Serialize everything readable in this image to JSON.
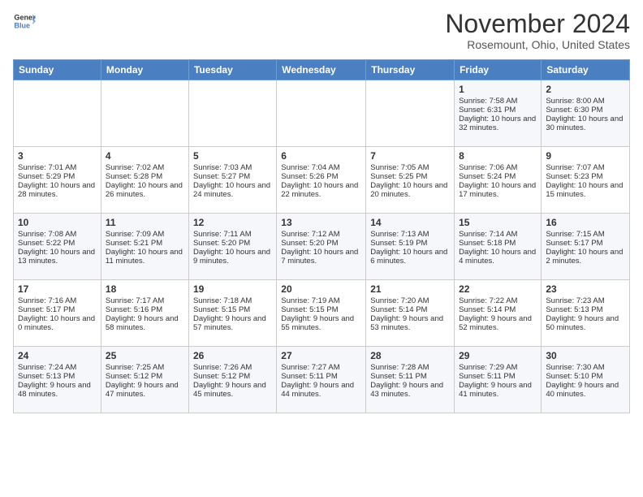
{
  "logo": {
    "line1": "General",
    "line2": "Blue"
  },
  "title": "November 2024",
  "location": "Rosemount, Ohio, United States",
  "headers": [
    "Sunday",
    "Monday",
    "Tuesday",
    "Wednesday",
    "Thursday",
    "Friday",
    "Saturday"
  ],
  "rows": [
    [
      {
        "day": "",
        "sunrise": "",
        "sunset": "",
        "daylight": ""
      },
      {
        "day": "",
        "sunrise": "",
        "sunset": "",
        "daylight": ""
      },
      {
        "day": "",
        "sunrise": "",
        "sunset": "",
        "daylight": ""
      },
      {
        "day": "",
        "sunrise": "",
        "sunset": "",
        "daylight": ""
      },
      {
        "day": "",
        "sunrise": "",
        "sunset": "",
        "daylight": ""
      },
      {
        "day": "1",
        "sunrise": "Sunrise: 7:58 AM",
        "sunset": "Sunset: 6:31 PM",
        "daylight": "Daylight: 10 hours and 32 minutes."
      },
      {
        "day": "2",
        "sunrise": "Sunrise: 8:00 AM",
        "sunset": "Sunset: 6:30 PM",
        "daylight": "Daylight: 10 hours and 30 minutes."
      }
    ],
    [
      {
        "day": "3",
        "sunrise": "Sunrise: 7:01 AM",
        "sunset": "Sunset: 5:29 PM",
        "daylight": "Daylight: 10 hours and 28 minutes."
      },
      {
        "day": "4",
        "sunrise": "Sunrise: 7:02 AM",
        "sunset": "Sunset: 5:28 PM",
        "daylight": "Daylight: 10 hours and 26 minutes."
      },
      {
        "day": "5",
        "sunrise": "Sunrise: 7:03 AM",
        "sunset": "Sunset: 5:27 PM",
        "daylight": "Daylight: 10 hours and 24 minutes."
      },
      {
        "day": "6",
        "sunrise": "Sunrise: 7:04 AM",
        "sunset": "Sunset: 5:26 PM",
        "daylight": "Daylight: 10 hours and 22 minutes."
      },
      {
        "day": "7",
        "sunrise": "Sunrise: 7:05 AM",
        "sunset": "Sunset: 5:25 PM",
        "daylight": "Daylight: 10 hours and 20 minutes."
      },
      {
        "day": "8",
        "sunrise": "Sunrise: 7:06 AM",
        "sunset": "Sunset: 5:24 PM",
        "daylight": "Daylight: 10 hours and 17 minutes."
      },
      {
        "day": "9",
        "sunrise": "Sunrise: 7:07 AM",
        "sunset": "Sunset: 5:23 PM",
        "daylight": "Daylight: 10 hours and 15 minutes."
      }
    ],
    [
      {
        "day": "10",
        "sunrise": "Sunrise: 7:08 AM",
        "sunset": "Sunset: 5:22 PM",
        "daylight": "Daylight: 10 hours and 13 minutes."
      },
      {
        "day": "11",
        "sunrise": "Sunrise: 7:09 AM",
        "sunset": "Sunset: 5:21 PM",
        "daylight": "Daylight: 10 hours and 11 minutes."
      },
      {
        "day": "12",
        "sunrise": "Sunrise: 7:11 AM",
        "sunset": "Sunset: 5:20 PM",
        "daylight": "Daylight: 10 hours and 9 minutes."
      },
      {
        "day": "13",
        "sunrise": "Sunrise: 7:12 AM",
        "sunset": "Sunset: 5:20 PM",
        "daylight": "Daylight: 10 hours and 7 minutes."
      },
      {
        "day": "14",
        "sunrise": "Sunrise: 7:13 AM",
        "sunset": "Sunset: 5:19 PM",
        "daylight": "Daylight: 10 hours and 6 minutes."
      },
      {
        "day": "15",
        "sunrise": "Sunrise: 7:14 AM",
        "sunset": "Sunset: 5:18 PM",
        "daylight": "Daylight: 10 hours and 4 minutes."
      },
      {
        "day": "16",
        "sunrise": "Sunrise: 7:15 AM",
        "sunset": "Sunset: 5:17 PM",
        "daylight": "Daylight: 10 hours and 2 minutes."
      }
    ],
    [
      {
        "day": "17",
        "sunrise": "Sunrise: 7:16 AM",
        "sunset": "Sunset: 5:17 PM",
        "daylight": "Daylight: 10 hours and 0 minutes."
      },
      {
        "day": "18",
        "sunrise": "Sunrise: 7:17 AM",
        "sunset": "Sunset: 5:16 PM",
        "daylight": "Daylight: 9 hours and 58 minutes."
      },
      {
        "day": "19",
        "sunrise": "Sunrise: 7:18 AM",
        "sunset": "Sunset: 5:15 PM",
        "daylight": "Daylight: 9 hours and 57 minutes."
      },
      {
        "day": "20",
        "sunrise": "Sunrise: 7:19 AM",
        "sunset": "Sunset: 5:15 PM",
        "daylight": "Daylight: 9 hours and 55 minutes."
      },
      {
        "day": "21",
        "sunrise": "Sunrise: 7:20 AM",
        "sunset": "Sunset: 5:14 PM",
        "daylight": "Daylight: 9 hours and 53 minutes."
      },
      {
        "day": "22",
        "sunrise": "Sunrise: 7:22 AM",
        "sunset": "Sunset: 5:14 PM",
        "daylight": "Daylight: 9 hours and 52 minutes."
      },
      {
        "day": "23",
        "sunrise": "Sunrise: 7:23 AM",
        "sunset": "Sunset: 5:13 PM",
        "daylight": "Daylight: 9 hours and 50 minutes."
      }
    ],
    [
      {
        "day": "24",
        "sunrise": "Sunrise: 7:24 AM",
        "sunset": "Sunset: 5:13 PM",
        "daylight": "Daylight: 9 hours and 48 minutes."
      },
      {
        "day": "25",
        "sunrise": "Sunrise: 7:25 AM",
        "sunset": "Sunset: 5:12 PM",
        "daylight": "Daylight: 9 hours and 47 minutes."
      },
      {
        "day": "26",
        "sunrise": "Sunrise: 7:26 AM",
        "sunset": "Sunset: 5:12 PM",
        "daylight": "Daylight: 9 hours and 45 minutes."
      },
      {
        "day": "27",
        "sunrise": "Sunrise: 7:27 AM",
        "sunset": "Sunset: 5:11 PM",
        "daylight": "Daylight: 9 hours and 44 minutes."
      },
      {
        "day": "28",
        "sunrise": "Sunrise: 7:28 AM",
        "sunset": "Sunset: 5:11 PM",
        "daylight": "Daylight: 9 hours and 43 minutes."
      },
      {
        "day": "29",
        "sunrise": "Sunrise: 7:29 AM",
        "sunset": "Sunset: 5:11 PM",
        "daylight": "Daylight: 9 hours and 41 minutes."
      },
      {
        "day": "30",
        "sunrise": "Sunrise: 7:30 AM",
        "sunset": "Sunset: 5:10 PM",
        "daylight": "Daylight: 9 hours and 40 minutes."
      }
    ]
  ]
}
